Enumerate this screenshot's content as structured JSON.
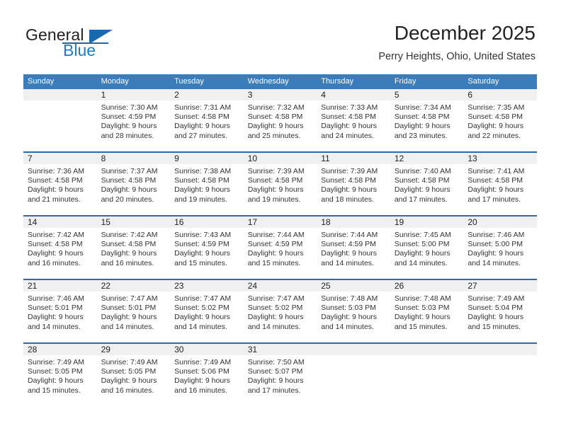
{
  "brand": {
    "word_top": "General",
    "word_bottom": "Blue",
    "triangle_color": "#1a69ad",
    "blue_color": "#1c7fc4"
  },
  "header": {
    "title": "December 2025",
    "location": "Perry Heights, Ohio, United States"
  },
  "theme": {
    "header_blue": "#3b7cba",
    "row_divider_blue": "#2a6aad",
    "day_band_gray": "#f0f0f0"
  },
  "weekday_headers": [
    "Sunday",
    "Monday",
    "Tuesday",
    "Wednesday",
    "Thursday",
    "Friday",
    "Saturday"
  ],
  "weeks": [
    [
      {
        "day": "",
        "sunrise": "",
        "sunset": "",
        "daylight_line1": "",
        "daylight_line2": ""
      },
      {
        "day": "1",
        "sunrise": "Sunrise: 7:30 AM",
        "sunset": "Sunset: 4:59 PM",
        "daylight_line1": "Daylight: 9 hours",
        "daylight_line2": "and 28 minutes."
      },
      {
        "day": "2",
        "sunrise": "Sunrise: 7:31 AM",
        "sunset": "Sunset: 4:58 PM",
        "daylight_line1": "Daylight: 9 hours",
        "daylight_line2": "and 27 minutes."
      },
      {
        "day": "3",
        "sunrise": "Sunrise: 7:32 AM",
        "sunset": "Sunset: 4:58 PM",
        "daylight_line1": "Daylight: 9 hours",
        "daylight_line2": "and 25 minutes."
      },
      {
        "day": "4",
        "sunrise": "Sunrise: 7:33 AM",
        "sunset": "Sunset: 4:58 PM",
        "daylight_line1": "Daylight: 9 hours",
        "daylight_line2": "and 24 minutes."
      },
      {
        "day": "5",
        "sunrise": "Sunrise: 7:34 AM",
        "sunset": "Sunset: 4:58 PM",
        "daylight_line1": "Daylight: 9 hours",
        "daylight_line2": "and 23 minutes."
      },
      {
        "day": "6",
        "sunrise": "Sunrise: 7:35 AM",
        "sunset": "Sunset: 4:58 PM",
        "daylight_line1": "Daylight: 9 hours",
        "daylight_line2": "and 22 minutes."
      }
    ],
    [
      {
        "day": "7",
        "sunrise": "Sunrise: 7:36 AM",
        "sunset": "Sunset: 4:58 PM",
        "daylight_line1": "Daylight: 9 hours",
        "daylight_line2": "and 21 minutes."
      },
      {
        "day": "8",
        "sunrise": "Sunrise: 7:37 AM",
        "sunset": "Sunset: 4:58 PM",
        "daylight_line1": "Daylight: 9 hours",
        "daylight_line2": "and 20 minutes."
      },
      {
        "day": "9",
        "sunrise": "Sunrise: 7:38 AM",
        "sunset": "Sunset: 4:58 PM",
        "daylight_line1": "Daylight: 9 hours",
        "daylight_line2": "and 19 minutes."
      },
      {
        "day": "10",
        "sunrise": "Sunrise: 7:39 AM",
        "sunset": "Sunset: 4:58 PM",
        "daylight_line1": "Daylight: 9 hours",
        "daylight_line2": "and 19 minutes."
      },
      {
        "day": "11",
        "sunrise": "Sunrise: 7:39 AM",
        "sunset": "Sunset: 4:58 PM",
        "daylight_line1": "Daylight: 9 hours",
        "daylight_line2": "and 18 minutes."
      },
      {
        "day": "12",
        "sunrise": "Sunrise: 7:40 AM",
        "sunset": "Sunset: 4:58 PM",
        "daylight_line1": "Daylight: 9 hours",
        "daylight_line2": "and 17 minutes."
      },
      {
        "day": "13",
        "sunrise": "Sunrise: 7:41 AM",
        "sunset": "Sunset: 4:58 PM",
        "daylight_line1": "Daylight: 9 hours",
        "daylight_line2": "and 17 minutes."
      }
    ],
    [
      {
        "day": "14",
        "sunrise": "Sunrise: 7:42 AM",
        "sunset": "Sunset: 4:58 PM",
        "daylight_line1": "Daylight: 9 hours",
        "daylight_line2": "and 16 minutes."
      },
      {
        "day": "15",
        "sunrise": "Sunrise: 7:42 AM",
        "sunset": "Sunset: 4:58 PM",
        "daylight_line1": "Daylight: 9 hours",
        "daylight_line2": "and 16 minutes."
      },
      {
        "day": "16",
        "sunrise": "Sunrise: 7:43 AM",
        "sunset": "Sunset: 4:59 PM",
        "daylight_line1": "Daylight: 9 hours",
        "daylight_line2": "and 15 minutes."
      },
      {
        "day": "17",
        "sunrise": "Sunrise: 7:44 AM",
        "sunset": "Sunset: 4:59 PM",
        "daylight_line1": "Daylight: 9 hours",
        "daylight_line2": "and 15 minutes."
      },
      {
        "day": "18",
        "sunrise": "Sunrise: 7:44 AM",
        "sunset": "Sunset: 4:59 PM",
        "daylight_line1": "Daylight: 9 hours",
        "daylight_line2": "and 14 minutes."
      },
      {
        "day": "19",
        "sunrise": "Sunrise: 7:45 AM",
        "sunset": "Sunset: 5:00 PM",
        "daylight_line1": "Daylight: 9 hours",
        "daylight_line2": "and 14 minutes."
      },
      {
        "day": "20",
        "sunrise": "Sunrise: 7:46 AM",
        "sunset": "Sunset: 5:00 PM",
        "daylight_line1": "Daylight: 9 hours",
        "daylight_line2": "and 14 minutes."
      }
    ],
    [
      {
        "day": "21",
        "sunrise": "Sunrise: 7:46 AM",
        "sunset": "Sunset: 5:01 PM",
        "daylight_line1": "Daylight: 9 hours",
        "daylight_line2": "and 14 minutes."
      },
      {
        "day": "22",
        "sunrise": "Sunrise: 7:47 AM",
        "sunset": "Sunset: 5:01 PM",
        "daylight_line1": "Daylight: 9 hours",
        "daylight_line2": "and 14 minutes."
      },
      {
        "day": "23",
        "sunrise": "Sunrise: 7:47 AM",
        "sunset": "Sunset: 5:02 PM",
        "daylight_line1": "Daylight: 9 hours",
        "daylight_line2": "and 14 minutes."
      },
      {
        "day": "24",
        "sunrise": "Sunrise: 7:47 AM",
        "sunset": "Sunset: 5:02 PM",
        "daylight_line1": "Daylight: 9 hours",
        "daylight_line2": "and 14 minutes."
      },
      {
        "day": "25",
        "sunrise": "Sunrise: 7:48 AM",
        "sunset": "Sunset: 5:03 PM",
        "daylight_line1": "Daylight: 9 hours",
        "daylight_line2": "and 14 minutes."
      },
      {
        "day": "26",
        "sunrise": "Sunrise: 7:48 AM",
        "sunset": "Sunset: 5:03 PM",
        "daylight_line1": "Daylight: 9 hours",
        "daylight_line2": "and 15 minutes."
      },
      {
        "day": "27",
        "sunrise": "Sunrise: 7:49 AM",
        "sunset": "Sunset: 5:04 PM",
        "daylight_line1": "Daylight: 9 hours",
        "daylight_line2": "and 15 minutes."
      }
    ],
    [
      {
        "day": "28",
        "sunrise": "Sunrise: 7:49 AM",
        "sunset": "Sunset: 5:05 PM",
        "daylight_line1": "Daylight: 9 hours",
        "daylight_line2": "and 15 minutes."
      },
      {
        "day": "29",
        "sunrise": "Sunrise: 7:49 AM",
        "sunset": "Sunset: 5:05 PM",
        "daylight_line1": "Daylight: 9 hours",
        "daylight_line2": "and 16 minutes."
      },
      {
        "day": "30",
        "sunrise": "Sunrise: 7:49 AM",
        "sunset": "Sunset: 5:06 PM",
        "daylight_line1": "Daylight: 9 hours",
        "daylight_line2": "and 16 minutes."
      },
      {
        "day": "31",
        "sunrise": "Sunrise: 7:50 AM",
        "sunset": "Sunset: 5:07 PM",
        "daylight_line1": "Daylight: 9 hours",
        "daylight_line2": "and 17 minutes."
      },
      {
        "day": "",
        "sunrise": "",
        "sunset": "",
        "daylight_line1": "",
        "daylight_line2": ""
      },
      {
        "day": "",
        "sunrise": "",
        "sunset": "",
        "daylight_line1": "",
        "daylight_line2": ""
      },
      {
        "day": "",
        "sunrise": "",
        "sunset": "",
        "daylight_line1": "",
        "daylight_line2": ""
      }
    ]
  ]
}
